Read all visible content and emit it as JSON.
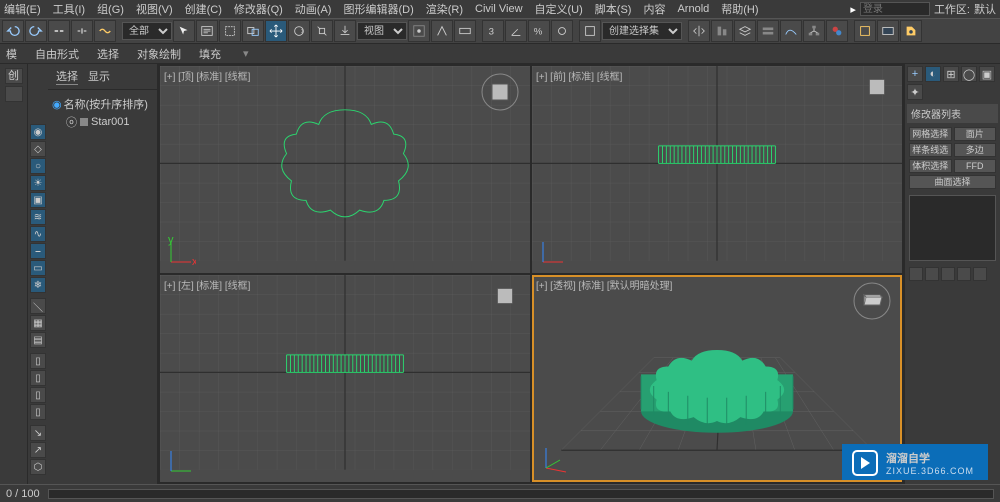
{
  "menu": {
    "items": [
      "编辑(E)",
      "工具(I)",
      "组(G)",
      "视图(V)",
      "创建(C)",
      "修改器(Q)",
      "动画(A)",
      "图形编辑器(D)",
      "渲染(R)",
      "Civil View",
      "自定义(U)",
      "脚本(S)",
      "内容",
      "Arnold",
      "帮助(H)"
    ],
    "search_placeholder": "登录",
    "workspace_label": "工作区:",
    "workspace_value": "默认"
  },
  "toolbar": {
    "filter_all": "全部",
    "view_label": "视图",
    "selset_label": "创建选择集"
  },
  "subtoolbar": {
    "items": [
      "模",
      "自由形式",
      "选择",
      "对象绘制",
      "填充"
    ]
  },
  "left_dock": {
    "create_label": "创"
  },
  "scene": {
    "tabs": [
      "选择",
      "显示"
    ],
    "sort_label": "名称(按升序排序)",
    "nodes": [
      "Star001"
    ]
  },
  "viewports": {
    "top": {
      "label": "[+] [顶] [标准] [线框]"
    },
    "front": {
      "label": "[+] [前] [标准] [线框]"
    },
    "left": {
      "label": "[+] [左] [标准] [线框]"
    },
    "persp": {
      "label": "[+] [透视] [标准] [默认明暗处理]"
    }
  },
  "cmdpanel": {
    "modlist_title": "修改器列表",
    "buttons": [
      "网格选择",
      "面片",
      "样条线选择",
      "多边",
      "体积选择",
      "FFD",
      "曲面选择"
    ]
  },
  "status": {
    "frames": "0 / 100"
  },
  "watermark": {
    "title": "溜溜自学",
    "sub": "ZIXUE.3D66.COM"
  },
  "colors": {
    "grid": "#636363",
    "grid_major": "#2f2f2f",
    "wire": "#2bd66f",
    "shade1": "#2fbf84",
    "shade2": "#27a071",
    "accent": "#d89028",
    "blue": "#0b6db8"
  }
}
